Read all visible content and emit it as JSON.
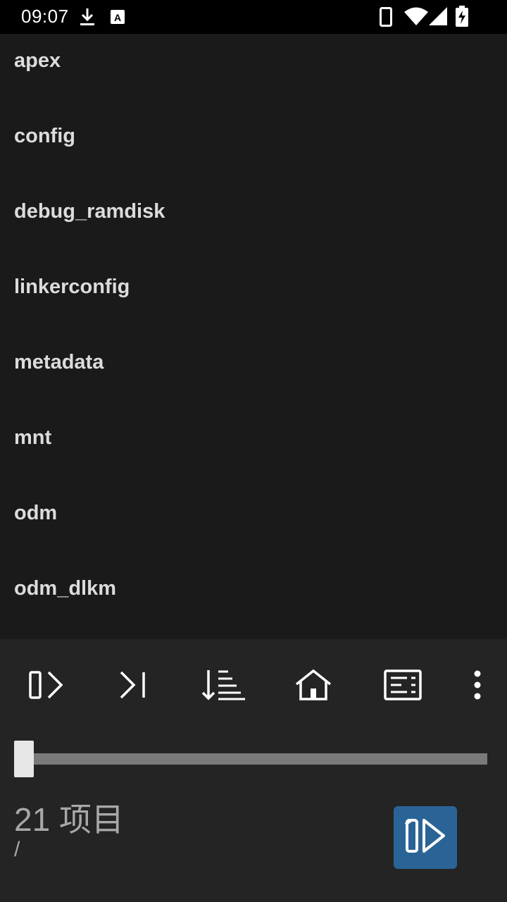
{
  "status_bar": {
    "time": "09:07",
    "icons": [
      "download-icon",
      "a-box-icon",
      "phone-icon",
      "wifi-icon",
      "signal-icon",
      "battery-charging-icon"
    ]
  },
  "files": [
    {
      "name": "apex"
    },
    {
      "name": "config"
    },
    {
      "name": "debug_ramdisk"
    },
    {
      "name": "linkerconfig"
    },
    {
      "name": "metadata"
    },
    {
      "name": "mnt"
    },
    {
      "name": "odm"
    },
    {
      "name": "odm_dlkm"
    }
  ],
  "toolbar": {
    "buttons": [
      "open-panel-icon",
      "skip-to-end-icon",
      "sort-icon",
      "home-icon",
      "details-icon",
      "more-vert-icon"
    ]
  },
  "footer": {
    "item_count": "21 项目",
    "current_path": "/",
    "scroll_position": 0.0
  },
  "colors": {
    "background": "#1a1a1a",
    "panel": "#242424",
    "accent": "#2a6496",
    "text": "#dcdcdc"
  }
}
